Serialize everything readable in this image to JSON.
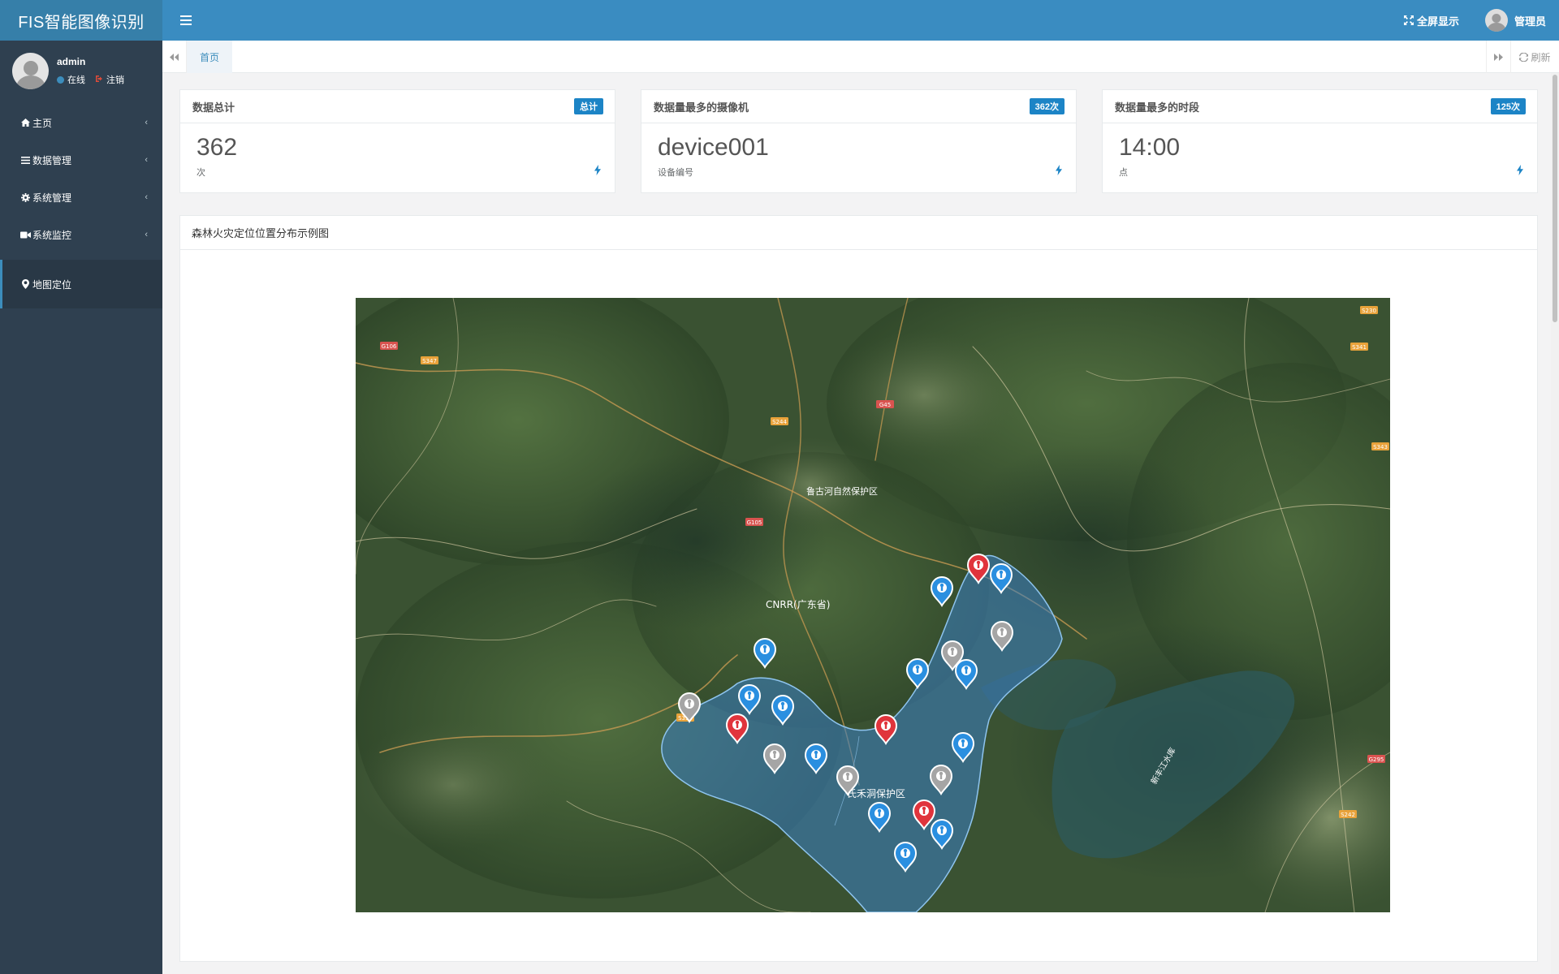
{
  "app": {
    "title": "FIS智能图像识别"
  },
  "header": {
    "fullscreen_label": "全屏显示",
    "user_label": "管理员"
  },
  "sidebar": {
    "user": {
      "name": "admin",
      "status": "在线",
      "logout": "注销"
    },
    "items": [
      {
        "label": "主页",
        "icon": "home-icon"
      },
      {
        "label": "数据管理",
        "icon": "list-icon"
      },
      {
        "label": "系统管理",
        "icon": "gear-icon"
      },
      {
        "label": "系统监控",
        "icon": "video-camera-icon"
      },
      {
        "label": "地图定位",
        "icon": "map-marker-icon"
      }
    ]
  },
  "tabs": {
    "home": "首页",
    "refresh": "刷新"
  },
  "cards": [
    {
      "title": "数据总计",
      "badge": "总计",
      "value": "362",
      "sub": "次"
    },
    {
      "title": "数据量最多的摄像机",
      "badge": "362次",
      "value": "device001",
      "sub": "设备编号"
    },
    {
      "title": "数据量最多的时段",
      "badge": "125次",
      "value": "14:00",
      "sub": "点"
    }
  ],
  "map": {
    "title": "森林火灾定位位置分布示例图",
    "labels": {
      "reserve_north": "鲁古河自然保护区",
      "cnrr": "CNRR(广东省)",
      "reserve_south": "氏禾洞保护区",
      "river": "新丰江水库"
    },
    "road_tags": [
      "G106",
      "S347",
      "G105",
      "S244",
      "G45",
      "S353",
      "S341",
      "S343",
      "G295",
      "S242",
      "S230"
    ],
    "colors": {
      "marker_blue": "#2a8fe0",
      "marker_red": "#e0343c",
      "marker_gray": "#a5a5a5",
      "region_fill": "#3b7fc4"
    },
    "markers": [
      {
        "type": "red"
      },
      {
        "type": "blue"
      },
      {
        "type": "blue"
      },
      {
        "type": "gray"
      },
      {
        "type": "gray"
      },
      {
        "type": "blue"
      },
      {
        "type": "blue"
      },
      {
        "type": "blue"
      },
      {
        "type": "blue"
      },
      {
        "type": "blue"
      },
      {
        "type": "gray"
      },
      {
        "type": "red"
      },
      {
        "type": "gray"
      },
      {
        "type": "blue"
      },
      {
        "type": "red"
      },
      {
        "type": "blue"
      },
      {
        "type": "gray"
      },
      {
        "type": "gray"
      },
      {
        "type": "blue"
      },
      {
        "type": "red"
      },
      {
        "type": "blue"
      },
      {
        "type": "blue"
      }
    ]
  }
}
